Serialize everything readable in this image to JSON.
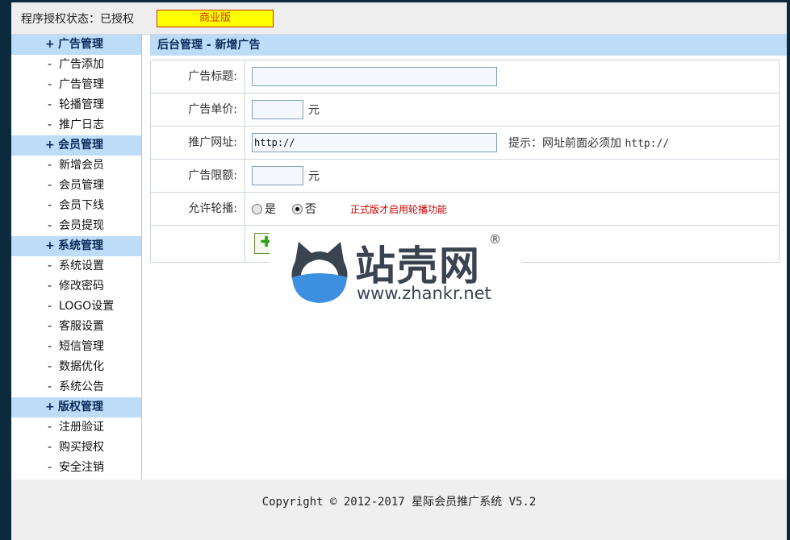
{
  "header": {
    "license_status": "程序授权状态：已授权",
    "edition_label": "商业版"
  },
  "sidebar": {
    "groups": [
      {
        "title": "广告管理",
        "items": [
          "广告添加",
          "广告管理",
          "轮播管理",
          "推广日志"
        ]
      },
      {
        "title": "会员管理",
        "items": [
          "新增会员",
          "会员管理",
          "会员下线",
          "会员提现"
        ]
      },
      {
        "title": "系统管理",
        "items": [
          "系统设置",
          "修改密码",
          "LOGO设置",
          "客服设置",
          "短信管理",
          "数据优化",
          "系统公告"
        ]
      },
      {
        "title": "版权管理",
        "items": [
          "注册验证",
          "购买授权",
          "安全注销"
        ]
      }
    ],
    "plus_symbol": "+",
    "dash_symbol": "-"
  },
  "main": {
    "breadcrumb": "后台管理 - 新增广告",
    "form": {
      "title_label": "广告标题:",
      "title_value": "",
      "price_label": "广告单价:",
      "price_value": "",
      "price_unit": "元",
      "url_label": "推广网址:",
      "url_value": "http://",
      "url_hint_prefix": "提示：网址前面必须加",
      "url_hint_code": "http://",
      "limit_label": "广告限额:",
      "limit_value": "",
      "limit_unit": "元",
      "carousel_label": "允许轮播:",
      "carousel_options": [
        {
          "label": "是",
          "checked": false
        },
        {
          "label": "否",
          "checked": true
        }
      ],
      "carousel_warning": "正式版才启用轮播功能",
      "submit_icon": "✚"
    }
  },
  "watermark": {
    "title": "站壳网",
    "registered": "®",
    "url": "www.zhankr.net"
  },
  "footer": {
    "copyright": "Copyright © 2012-2017 星际会员推广系统 V5.2"
  },
  "colors": {
    "sidebar_group_bg": "#bcdcf7",
    "edition_bg": "#ffff00",
    "warning": "#cc0000",
    "frame": "#0b2a3d"
  }
}
